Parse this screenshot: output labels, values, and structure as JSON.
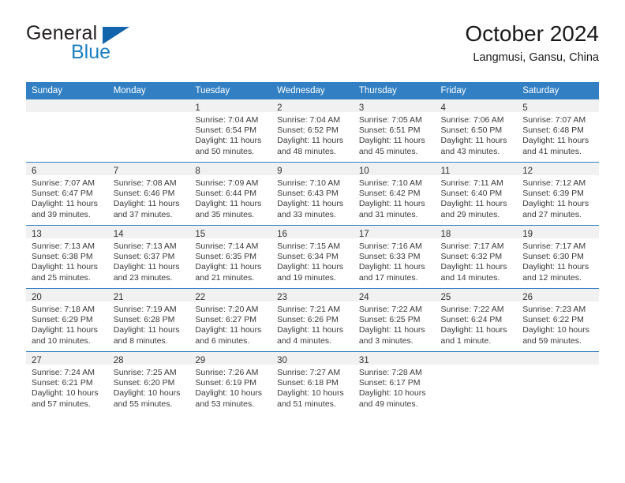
{
  "brand": {
    "name_top": "General",
    "name_bottom": "Blue",
    "triangle_color": "#1264ab",
    "blue_color": "#1d7fc3"
  },
  "header": {
    "title": "October 2024",
    "subtitle": "Langmusi, Gansu, China"
  },
  "theme": {
    "header_blue": "#3280c3",
    "daynum_strip": "#f1f1f1",
    "cell_text": "#3a3a3a"
  },
  "weekdays": [
    "Sunday",
    "Monday",
    "Tuesday",
    "Wednesday",
    "Thursday",
    "Friday",
    "Saturday"
  ],
  "labels": {
    "sunrise_prefix": "Sunrise:",
    "sunset_prefix": "Sunset:",
    "daylight_prefix": "Daylight:"
  },
  "weeks": [
    [
      {
        "empty": true
      },
      {
        "empty": true
      },
      {
        "day": "1",
        "sunrise": "Sunrise: 7:04 AM",
        "sunset": "Sunset: 6:54 PM",
        "daylight_1": "Daylight: 11 hours",
        "daylight_2": "and 50 minutes."
      },
      {
        "day": "2",
        "sunrise": "Sunrise: 7:04 AM",
        "sunset": "Sunset: 6:52 PM",
        "daylight_1": "Daylight: 11 hours",
        "daylight_2": "and 48 minutes."
      },
      {
        "day": "3",
        "sunrise": "Sunrise: 7:05 AM",
        "sunset": "Sunset: 6:51 PM",
        "daylight_1": "Daylight: 11 hours",
        "daylight_2": "and 45 minutes."
      },
      {
        "day": "4",
        "sunrise": "Sunrise: 7:06 AM",
        "sunset": "Sunset: 6:50 PM",
        "daylight_1": "Daylight: 11 hours",
        "daylight_2": "and 43 minutes."
      },
      {
        "day": "5",
        "sunrise": "Sunrise: 7:07 AM",
        "sunset": "Sunset: 6:48 PM",
        "daylight_1": "Daylight: 11 hours",
        "daylight_2": "and 41 minutes."
      }
    ],
    [
      {
        "day": "6",
        "sunrise": "Sunrise: 7:07 AM",
        "sunset": "Sunset: 6:47 PM",
        "daylight_1": "Daylight: 11 hours",
        "daylight_2": "and 39 minutes."
      },
      {
        "day": "7",
        "sunrise": "Sunrise: 7:08 AM",
        "sunset": "Sunset: 6:46 PM",
        "daylight_1": "Daylight: 11 hours",
        "daylight_2": "and 37 minutes."
      },
      {
        "day": "8",
        "sunrise": "Sunrise: 7:09 AM",
        "sunset": "Sunset: 6:44 PM",
        "daylight_1": "Daylight: 11 hours",
        "daylight_2": "and 35 minutes."
      },
      {
        "day": "9",
        "sunrise": "Sunrise: 7:10 AM",
        "sunset": "Sunset: 6:43 PM",
        "daylight_1": "Daylight: 11 hours",
        "daylight_2": "and 33 minutes."
      },
      {
        "day": "10",
        "sunrise": "Sunrise: 7:10 AM",
        "sunset": "Sunset: 6:42 PM",
        "daylight_1": "Daylight: 11 hours",
        "daylight_2": "and 31 minutes."
      },
      {
        "day": "11",
        "sunrise": "Sunrise: 7:11 AM",
        "sunset": "Sunset: 6:40 PM",
        "daylight_1": "Daylight: 11 hours",
        "daylight_2": "and 29 minutes."
      },
      {
        "day": "12",
        "sunrise": "Sunrise: 7:12 AM",
        "sunset": "Sunset: 6:39 PM",
        "daylight_1": "Daylight: 11 hours",
        "daylight_2": "and 27 minutes."
      }
    ],
    [
      {
        "day": "13",
        "sunrise": "Sunrise: 7:13 AM",
        "sunset": "Sunset: 6:38 PM",
        "daylight_1": "Daylight: 11 hours",
        "daylight_2": "and 25 minutes."
      },
      {
        "day": "14",
        "sunrise": "Sunrise: 7:13 AM",
        "sunset": "Sunset: 6:37 PM",
        "daylight_1": "Daylight: 11 hours",
        "daylight_2": "and 23 minutes."
      },
      {
        "day": "15",
        "sunrise": "Sunrise: 7:14 AM",
        "sunset": "Sunset: 6:35 PM",
        "daylight_1": "Daylight: 11 hours",
        "daylight_2": "and 21 minutes."
      },
      {
        "day": "16",
        "sunrise": "Sunrise: 7:15 AM",
        "sunset": "Sunset: 6:34 PM",
        "daylight_1": "Daylight: 11 hours",
        "daylight_2": "and 19 minutes."
      },
      {
        "day": "17",
        "sunrise": "Sunrise: 7:16 AM",
        "sunset": "Sunset: 6:33 PM",
        "daylight_1": "Daylight: 11 hours",
        "daylight_2": "and 17 minutes."
      },
      {
        "day": "18",
        "sunrise": "Sunrise: 7:17 AM",
        "sunset": "Sunset: 6:32 PM",
        "daylight_1": "Daylight: 11 hours",
        "daylight_2": "and 14 minutes."
      },
      {
        "day": "19",
        "sunrise": "Sunrise: 7:17 AM",
        "sunset": "Sunset: 6:30 PM",
        "daylight_1": "Daylight: 11 hours",
        "daylight_2": "and 12 minutes."
      }
    ],
    [
      {
        "day": "20",
        "sunrise": "Sunrise: 7:18 AM",
        "sunset": "Sunset: 6:29 PM",
        "daylight_1": "Daylight: 11 hours",
        "daylight_2": "and 10 minutes."
      },
      {
        "day": "21",
        "sunrise": "Sunrise: 7:19 AM",
        "sunset": "Sunset: 6:28 PM",
        "daylight_1": "Daylight: 11 hours",
        "daylight_2": "and 8 minutes."
      },
      {
        "day": "22",
        "sunrise": "Sunrise: 7:20 AM",
        "sunset": "Sunset: 6:27 PM",
        "daylight_1": "Daylight: 11 hours",
        "daylight_2": "and 6 minutes."
      },
      {
        "day": "23",
        "sunrise": "Sunrise: 7:21 AM",
        "sunset": "Sunset: 6:26 PM",
        "daylight_1": "Daylight: 11 hours",
        "daylight_2": "and 4 minutes."
      },
      {
        "day": "24",
        "sunrise": "Sunrise: 7:22 AM",
        "sunset": "Sunset: 6:25 PM",
        "daylight_1": "Daylight: 11 hours",
        "daylight_2": "and 3 minutes."
      },
      {
        "day": "25",
        "sunrise": "Sunrise: 7:22 AM",
        "sunset": "Sunset: 6:24 PM",
        "daylight_1": "Daylight: 11 hours",
        "daylight_2": "and 1 minute."
      },
      {
        "day": "26",
        "sunrise": "Sunrise: 7:23 AM",
        "sunset": "Sunset: 6:22 PM",
        "daylight_1": "Daylight: 10 hours",
        "daylight_2": "and 59 minutes."
      }
    ],
    [
      {
        "day": "27",
        "sunrise": "Sunrise: 7:24 AM",
        "sunset": "Sunset: 6:21 PM",
        "daylight_1": "Daylight: 10 hours",
        "daylight_2": "and 57 minutes."
      },
      {
        "day": "28",
        "sunrise": "Sunrise: 7:25 AM",
        "sunset": "Sunset: 6:20 PM",
        "daylight_1": "Daylight: 10 hours",
        "daylight_2": "and 55 minutes."
      },
      {
        "day": "29",
        "sunrise": "Sunrise: 7:26 AM",
        "sunset": "Sunset: 6:19 PM",
        "daylight_1": "Daylight: 10 hours",
        "daylight_2": "and 53 minutes."
      },
      {
        "day": "30",
        "sunrise": "Sunrise: 7:27 AM",
        "sunset": "Sunset: 6:18 PM",
        "daylight_1": "Daylight: 10 hours",
        "daylight_2": "and 51 minutes."
      },
      {
        "day": "31",
        "sunrise": "Sunrise: 7:28 AM",
        "sunset": "Sunset: 6:17 PM",
        "daylight_1": "Daylight: 10 hours",
        "daylight_2": "and 49 minutes."
      },
      {
        "empty": true
      },
      {
        "empty": true
      }
    ]
  ]
}
